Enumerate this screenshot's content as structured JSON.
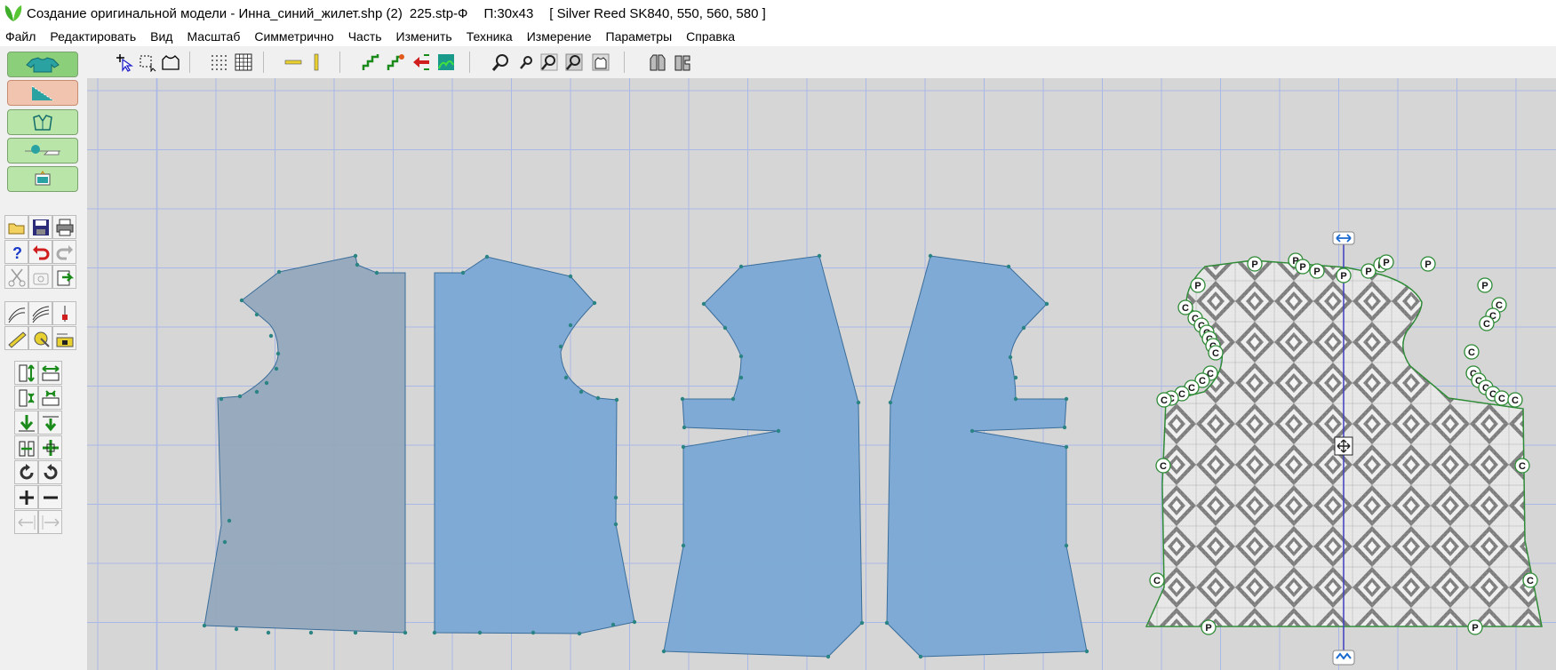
{
  "window": {
    "title": "Создание оригинальной модели - Инна_синий_жилет.shp (2)",
    "file_info": "225.stp-Ф",
    "size_info": "П:30x43",
    "machine_info": "[ Silver Reed SK840, 550, 560, 580 ]"
  },
  "menu": {
    "items": [
      "Файл",
      "Редактировать",
      "Вид",
      "Масштаб",
      "Симметрично",
      "Часть",
      "Изменить",
      "Техника",
      "Измерение",
      "Параметры",
      "Справка"
    ]
  },
  "colors": {
    "canvas_bg": "#d6d6d6",
    "grid_line": "#a9b8e6",
    "piece_fill": "#7aa8d5",
    "piece_fill_muted": "#94a8bd",
    "piece_stroke": "#3a6d9a",
    "node": "#2a8484",
    "axis": "#3f3fc2",
    "pattern_light": "#f0f0f0",
    "pattern_dark": "#7d7d7d",
    "pattern_outline": "#2d8a35",
    "accent_green": "#8ccf7a"
  },
  "toolbar": {
    "icons": [
      "select-pointer-icon",
      "select-node-icon",
      "shape-outline-icon",
      "dot-grid-icon",
      "grid-icon",
      "horizontal-ruler-icon",
      "vertical-ruler-icon",
      "stairs-icon",
      "stairs-node-icon",
      "arrow-left-icon",
      "fill-pattern-icon",
      "zoom-icon",
      "zoom-small-icon",
      "zoom-in-icon",
      "zoom-out-icon",
      "fit-window-icon",
      "front-view-icon",
      "side-view-icon"
    ]
  },
  "side_panel": {
    "mode_buttons": [
      "garment-icon",
      "pattern-layout-icon",
      "symmetry-icon",
      "machine-icon",
      "preview-icon"
    ],
    "tools": [
      "open-file-icon",
      "save-icon",
      "print-icon",
      "help-icon",
      "undo-icon",
      "redo-icon",
      "cut-icon",
      "copy-icon",
      "paste-icon",
      "curve-tool-icon",
      "curve-alt-icon",
      "node-tool-icon",
      "ruler-tool-icon",
      "measure-tape-icon",
      "measure-node-icon",
      "stretch-vertical-icon",
      "stretch-horizontal-icon",
      "shrink-vertical-icon",
      "shrink-horizontal-icon",
      "move-down-icon",
      "move-down-alt-icon",
      "mirror-icon",
      "move-all-icon",
      "rotate-cw-icon",
      "rotate-ccw-icon",
      "zoom-plus-icon",
      "zoom-minus-icon",
      "align-left-icon",
      "align-right-icon"
    ]
  },
  "point_markers": {
    "p_label": "P",
    "c_label": "C"
  }
}
